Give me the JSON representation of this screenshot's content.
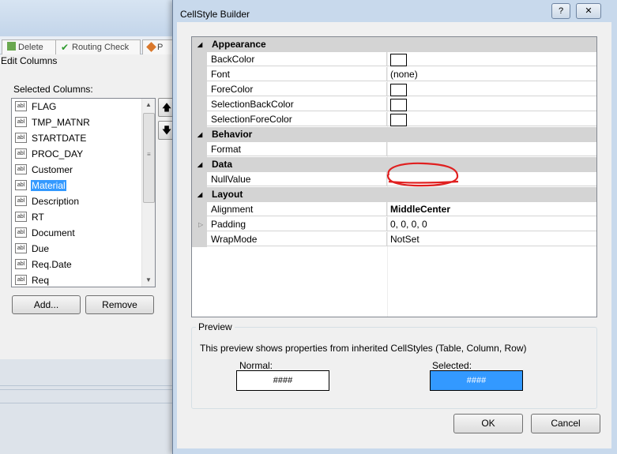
{
  "background_window": {
    "tabs": [
      "Delete",
      "Routing Check",
      "P"
    ],
    "title": "Edit Columns",
    "selected_columns_label": "Selected Columns:",
    "columns": [
      {
        "label": "FLAG",
        "selected": false
      },
      {
        "label": "TMP_MATNR",
        "selected": false
      },
      {
        "label": "STARTDATE",
        "selected": false
      },
      {
        "label": "PROC_DAY",
        "selected": false
      },
      {
        "label": "Customer",
        "selected": false
      },
      {
        "label": "Material",
        "selected": true
      },
      {
        "label": "Description",
        "selected": false
      },
      {
        "label": "RT",
        "selected": false
      },
      {
        "label": "Document",
        "selected": false
      },
      {
        "label": "Due",
        "selected": false
      },
      {
        "label": "Req.Date",
        "selected": false
      },
      {
        "label": "Req",
        "selected": false
      }
    ],
    "item_icon_text": "abl",
    "add_button": "Add...",
    "remove_button": "Remove",
    "move_up_icon": "arrow-up-icon",
    "move_down_icon": "arrow-down-icon"
  },
  "dialog": {
    "title": "CellStyle Builder",
    "help_button": "?",
    "close_button": "✕",
    "property_grid": {
      "categories": [
        {
          "name": "Appearance",
          "properties": [
            {
              "name": "BackColor",
              "value": "",
              "kind": "color",
              "color": "#ffffff"
            },
            {
              "name": "Font",
              "value": "(none)",
              "kind": "text"
            },
            {
              "name": "ForeColor",
              "value": "",
              "kind": "color",
              "color": "#ffffff"
            },
            {
              "name": "SelectionBackColor",
              "value": "",
              "kind": "color",
              "color": "#ffffff"
            },
            {
              "name": "SelectionForeColor",
              "value": "",
              "kind": "color",
              "color": "#ffffff"
            }
          ]
        },
        {
          "name": "Behavior",
          "properties": [
            {
              "name": "Format",
              "value": "",
              "kind": "text"
            }
          ]
        },
        {
          "name": "Data",
          "properties": [
            {
              "name": "NullValue",
              "value": "",
              "kind": "text"
            }
          ]
        },
        {
          "name": "Layout",
          "properties": [
            {
              "name": "Alignment",
              "value": "MiddleCenter",
              "kind": "text",
              "bold": true
            },
            {
              "name": "Padding",
              "value": "0, 0, 0, 0",
              "kind": "text",
              "expandable": true
            },
            {
              "name": "WrapMode",
              "value": "NotSet",
              "kind": "text"
            }
          ]
        }
      ]
    },
    "preview": {
      "label": "Preview",
      "description": "This preview shows properties from inherited CellStyles (Table, Column, Row)",
      "normal_label": "Normal:",
      "normal_sample": "####",
      "selected_label": "Selected:",
      "selected_sample": "####",
      "selected_bg": "#3399ff"
    },
    "ok_button": "OK",
    "cancel_button": "Cancel",
    "annotation_color": "#e02020"
  }
}
